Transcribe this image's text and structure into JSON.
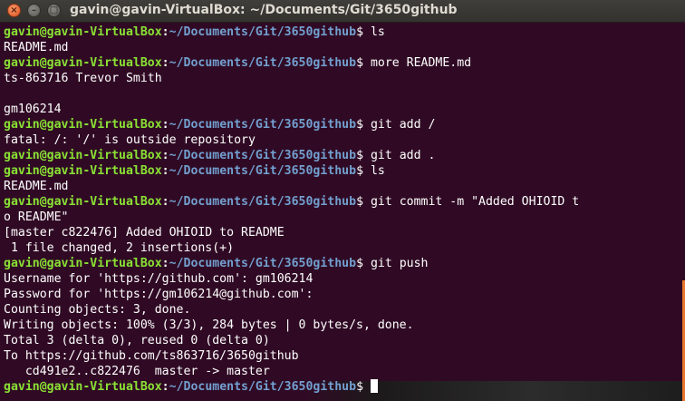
{
  "window": {
    "title": "gavin@gavin-VirtualBox: ~/Documents/Git/3650github",
    "close_glyph": "×",
    "minimize_glyph": "–",
    "maximize_glyph": "□"
  },
  "prompt": {
    "user_host": "gavin@gavin-VirtualBox",
    "separator": ":",
    "path": "~/Documents/Git/3650github",
    "symbol": "$ "
  },
  "terminal": {
    "lines": [
      {
        "type": "prompt",
        "text": "ls"
      },
      {
        "type": "output",
        "text": "README.md"
      },
      {
        "type": "prompt",
        "text": "more README.md"
      },
      {
        "type": "output",
        "text": "ts-863716 Trevor Smith"
      },
      {
        "type": "output",
        "text": ""
      },
      {
        "type": "output",
        "text": "gm106214"
      },
      {
        "type": "prompt",
        "text": "git add /"
      },
      {
        "type": "output",
        "text": "fatal: /: '/' is outside repository"
      },
      {
        "type": "prompt",
        "text": "git add ."
      },
      {
        "type": "prompt",
        "text": "ls"
      },
      {
        "type": "output",
        "text": "README.md"
      },
      {
        "type": "prompt",
        "text": "git commit -m \"Added OHIOID t"
      },
      {
        "type": "output",
        "text": "o README\""
      },
      {
        "type": "output",
        "text": "[master c822476] Added OHIOID to README"
      },
      {
        "type": "output",
        "text": " 1 file changed, 2 insertions(+)"
      },
      {
        "type": "prompt",
        "text": "git push"
      },
      {
        "type": "output",
        "text": "Username for 'https://github.com': gm106214"
      },
      {
        "type": "output",
        "text": "Password for 'https://gm106214@github.com':"
      },
      {
        "type": "output",
        "text": "Counting objects: 3, done."
      },
      {
        "type": "output",
        "text": "Writing objects: 100% (3/3), 284 bytes | 0 bytes/s, done."
      },
      {
        "type": "output",
        "text": "Total 3 (delta 0), reused 0 (delta 0)"
      },
      {
        "type": "output",
        "text": "To https://github.com/ts863716/3650github"
      },
      {
        "type": "output",
        "text": "   cd491e2..c822476  master -> master"
      },
      {
        "type": "prompt_cursor",
        "text": ""
      }
    ]
  },
  "colors": {
    "background": "#300a24",
    "user_host": "#8ae234",
    "path": "#729fcf",
    "text": "#ffffff",
    "scrollbar": "#e9762e"
  }
}
